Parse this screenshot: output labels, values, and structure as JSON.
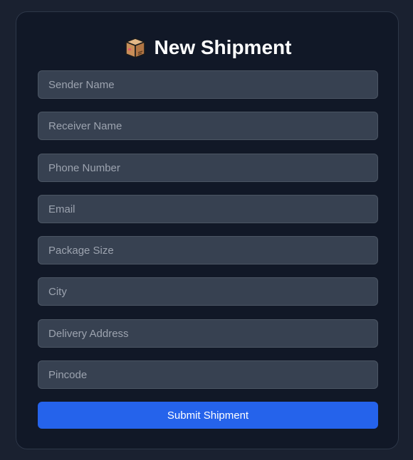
{
  "form": {
    "icon": "package-box-icon",
    "title": "New Shipment",
    "fields": [
      {
        "placeholder": "Sender Name",
        "value": ""
      },
      {
        "placeholder": "Receiver Name",
        "value": ""
      },
      {
        "placeholder": "Phone Number",
        "value": ""
      },
      {
        "placeholder": "Email",
        "value": ""
      },
      {
        "placeholder": "Package Size",
        "value": ""
      },
      {
        "placeholder": "City",
        "value": ""
      },
      {
        "placeholder": "Delivery Address",
        "value": ""
      },
      {
        "placeholder": "Pincode",
        "value": ""
      }
    ],
    "submit_label": "Submit Shipment"
  },
  "colors": {
    "page_background": "#1a2130",
    "card_background": "#111827",
    "input_background": "#374151",
    "accent": "#2563eb"
  }
}
